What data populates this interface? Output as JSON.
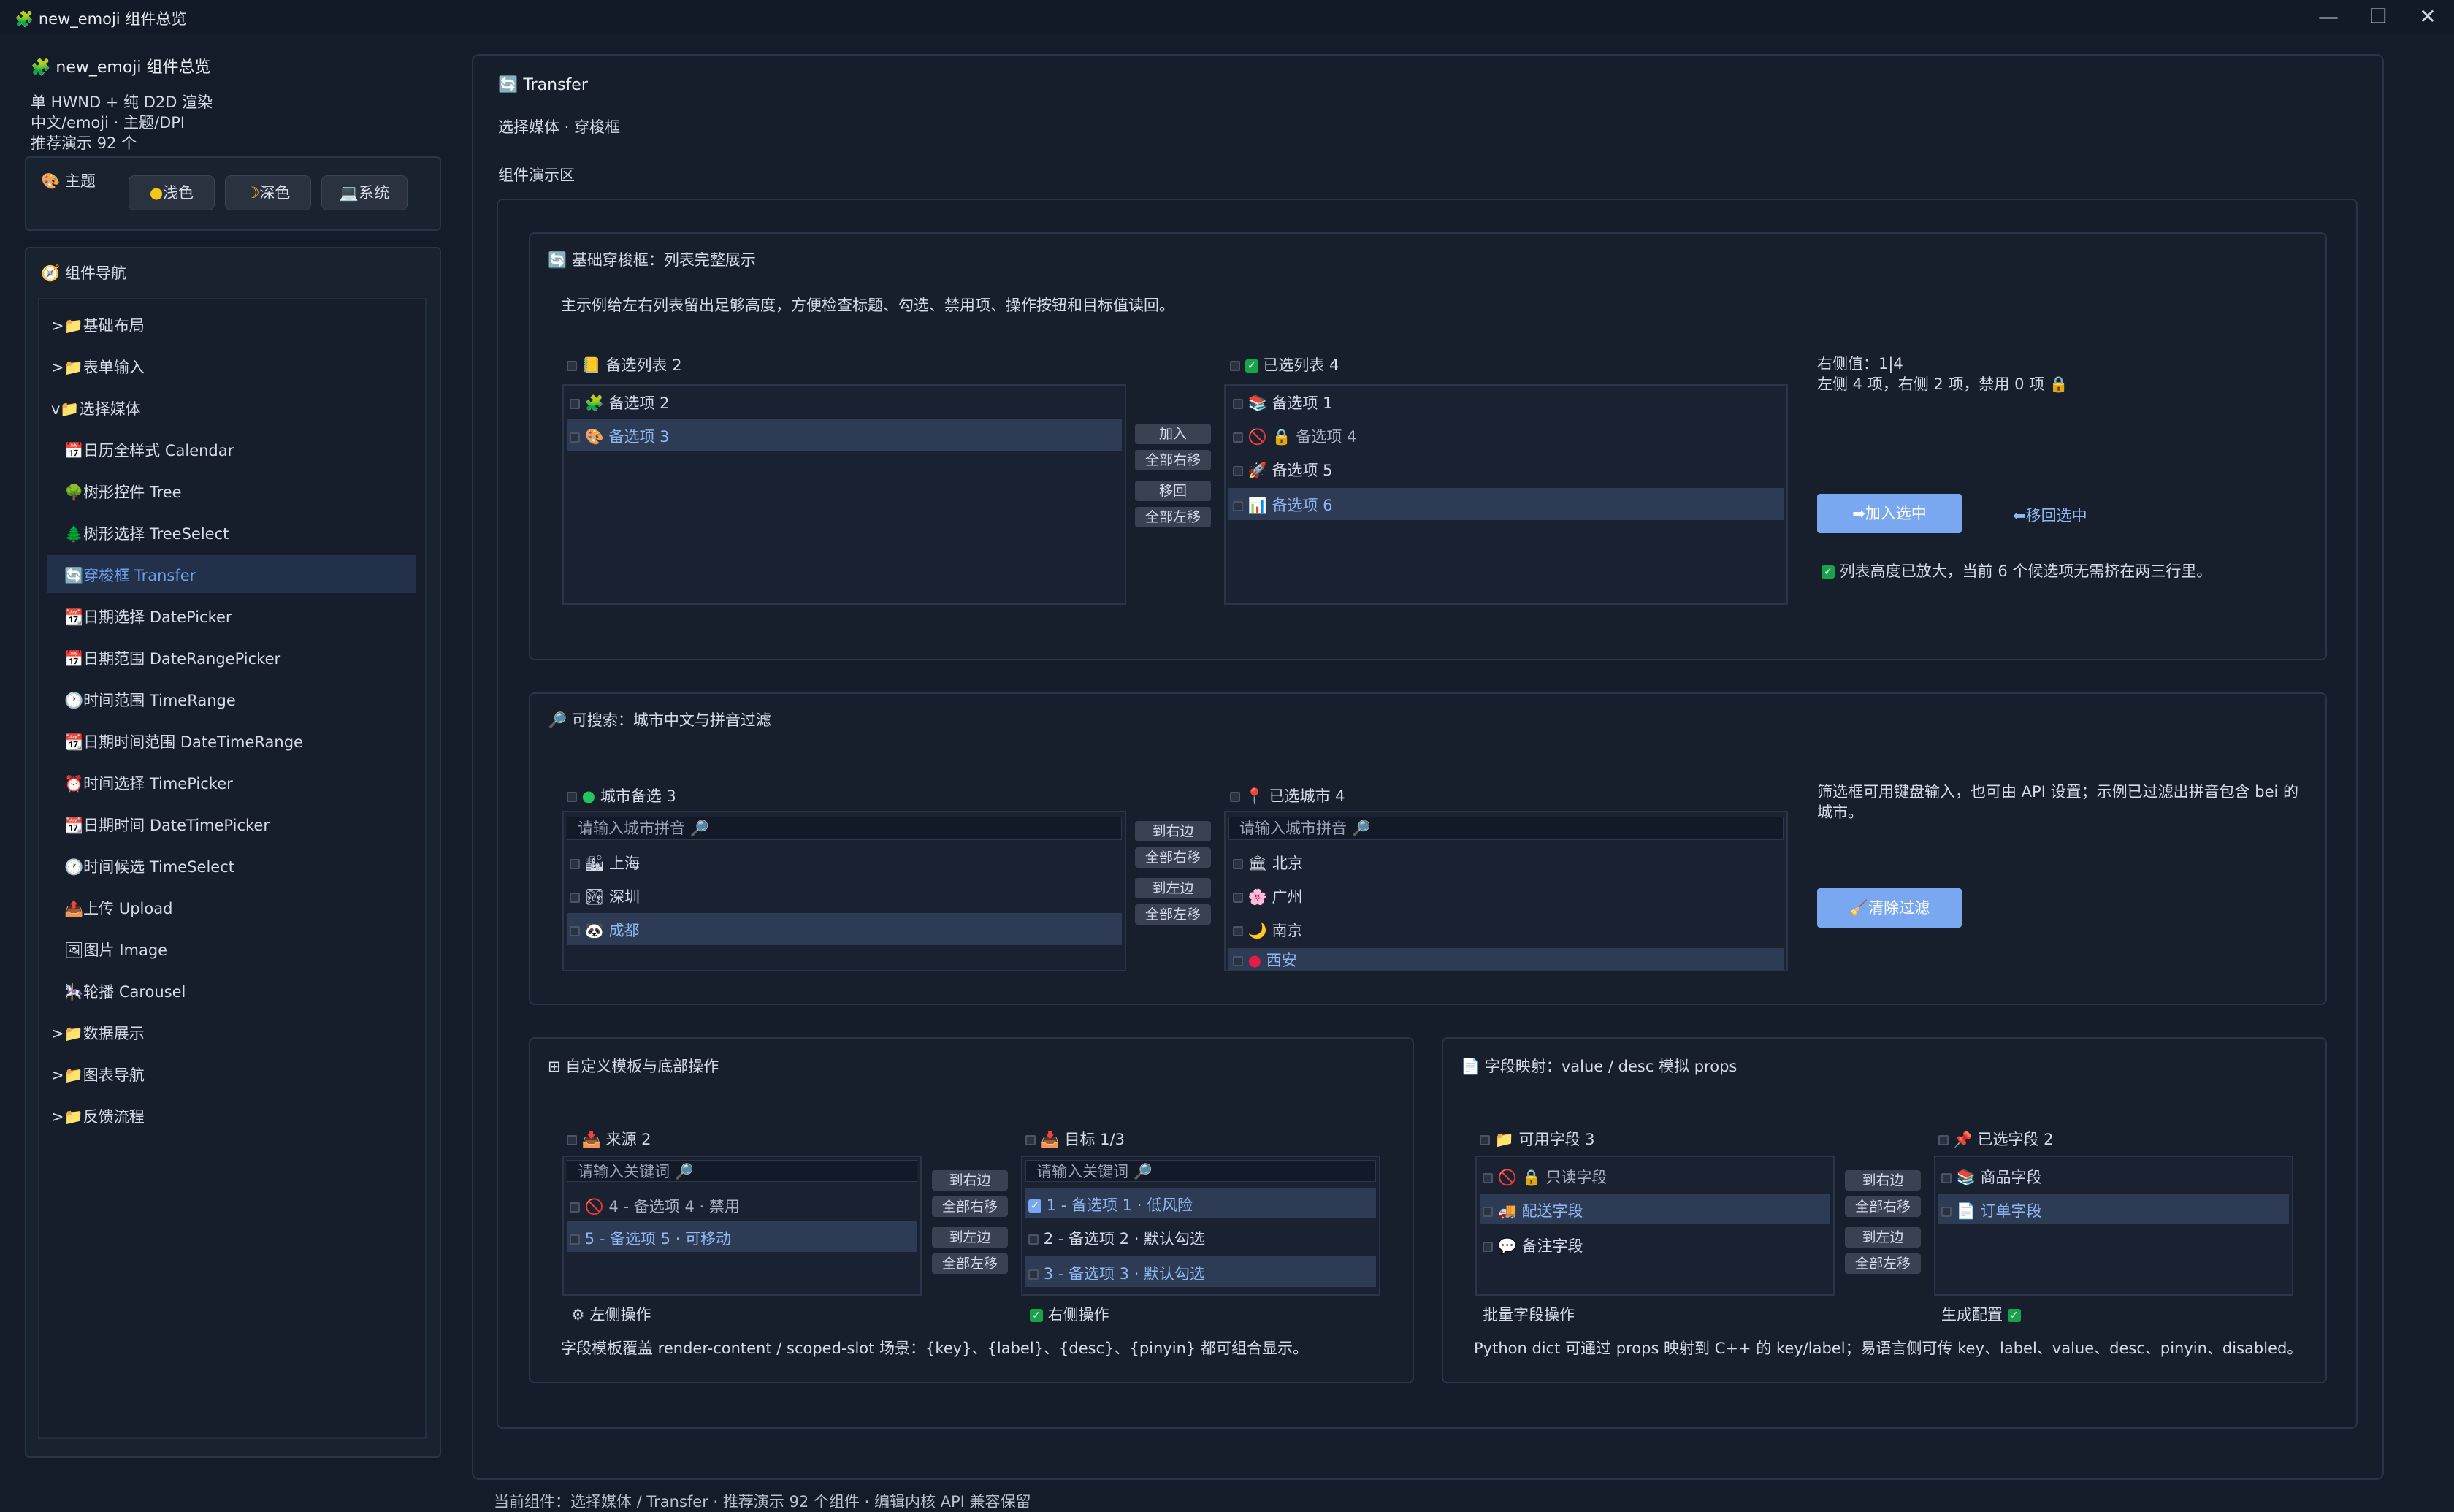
{
  "window": {
    "title": "new_emoji 组件总览",
    "app_icon": "🧩"
  },
  "sidebar": {
    "app_name": "new_emoji 组件总览",
    "info": [
      "单 HWND + 纯 D2D 渲染",
      "中文/emoji · 主题/DPI",
      "推荐演示 92 个"
    ],
    "theme": {
      "label": "主题",
      "icon": "🎨",
      "light": "浅色",
      "dark": "深色",
      "system": "系统"
    },
    "nav_title": "组件导航",
    "nav_icon": "🧭",
    "nav": [
      {
        "label": ">📁基础布局",
        "level": 0
      },
      {
        "label": ">📁表单输入",
        "level": 0
      },
      {
        "label": "v📁选择媒体",
        "level": 0
      },
      {
        "label": "📅日历全样式 Calendar",
        "level": 1
      },
      {
        "label": "🌳树形控件 Tree",
        "level": 1
      },
      {
        "label": "🌲树形选择 TreeSelect",
        "level": 1
      },
      {
        "label": "🔄穿梭框 Transfer",
        "level": 1,
        "selected": true
      },
      {
        "label": "📆日期选择 DatePicker",
        "level": 1
      },
      {
        "label": "📅日期范围 DateRangePicker",
        "level": 1
      },
      {
        "label": "🕐时间范围 TimeRange",
        "level": 1
      },
      {
        "label": "📆日期时间范围 DateTimeRange",
        "level": 1
      },
      {
        "label": "⏰时间选择 TimePicker",
        "level": 1
      },
      {
        "label": "📆日期时间 DateTimePicker",
        "level": 1
      },
      {
        "label": "🕐时间候选 TimeSelect",
        "level": 1
      },
      {
        "label": "📤上传 Upload",
        "level": 1
      },
      {
        "label": "🖼图片 Image",
        "level": 1
      },
      {
        "label": "🎠轮播 Carousel",
        "level": 1
      },
      {
        "label": ">📁数据展示",
        "level": 0
      },
      {
        "label": ">📁图表导航",
        "level": 0
      },
      {
        "label": ">📁反馈流程",
        "level": 0
      }
    ]
  },
  "main": {
    "title": "Transfer",
    "subtitle": "选择媒体 · 穿梭框",
    "demo_label": "组件演示区",
    "status": "当前组件：选择媒体 / Transfer · 推荐演示 92 个组件 · 编辑内核 API 兼容保留"
  },
  "sec1": {
    "title": "基础穿梭框：列表完整展示",
    "desc": "主示例给左右列表留出足够高度，方便检查标题、勾选、禁用项、操作按钮和目标值读回。",
    "left_title": "备选列表  2",
    "left_items": [
      "备选项 2",
      "备选项 3"
    ],
    "right_title": "已选列表  4",
    "right_items": [
      "备选项 1",
      "备选项 4",
      "备选项 5",
      "备选项 6"
    ],
    "ops": [
      "加入",
      "全部右移",
      "移回",
      "全部左移"
    ],
    "value_line1": "右侧值：1|4",
    "value_line2": "左侧 4 项，右侧 2 项，禁用 0 项 🔒",
    "btn_add": "➡加入选中",
    "btn_back": "⬅移回选中",
    "note": "列表高度已放大，当前 6 个候选项无需挤在两三行里。"
  },
  "sec2": {
    "title": "可搜索：城市中文与拼音过滤",
    "left_title": "城市备选  3",
    "right_title": "已选城市  4",
    "placeholder": "请输入城市拼音 🔎",
    "left_items": [
      "上海",
      "深圳",
      "成都"
    ],
    "right_items": [
      "北京",
      "广州",
      "南京",
      "西安"
    ],
    "ops": [
      "到右边",
      "全部右移",
      "到左边",
      "全部左移"
    ],
    "desc": "筛选框可用键盘输入，也可由 API 设置；示例已过滤出拼音包含 bei 的城市。",
    "btn_clear": "🧹清除过滤"
  },
  "sec3": {
    "title": "自定义模板与底部操作",
    "left_title": "来源  2",
    "right_title": "目标  1/3",
    "placeholder": "请输入关键词 🔎",
    "left_items": [
      "4 - 备选项 4 · 禁用",
      "5 - 备选项 5 · 可移动"
    ],
    "right_items": [
      "1 - 备选项 1 · 低风险",
      "2 - 备选项 2 · 默认勾选",
      "3 - 备选项 3 · 默认勾选"
    ],
    "ops": [
      "到右边",
      "全部右移",
      "到左边",
      "全部左移"
    ],
    "left_footer": "左侧操作",
    "right_footer": "右侧操作",
    "desc": "字段模板覆盖 render-content / scoped-slot 场景：{key}、{label}、{desc}、{pinyin} 都可组合显示。"
  },
  "sec4": {
    "title": "字段映射：value / desc 模拟 props",
    "left_title": "可用字段  3",
    "right_title": "已选字段  2",
    "left_items": [
      "只读字段",
      "配送字段",
      "备注字段"
    ],
    "right_items": [
      "商品字段",
      "订单字段"
    ],
    "ops": [
      "到右边",
      "全部右移",
      "到左边",
      "全部左移"
    ],
    "left_footer": "批量字段操作",
    "right_footer": "生成配置",
    "desc": "Python dict 可通过 props 映射到 C++ 的 key/label；易语言侧可传 key、label、value、desc、pinyin、disabled。"
  },
  "colors": {
    "bg": "#141c2a",
    "accent": "#7aa8f0",
    "selected_row": "#2d3b55",
    "check": "#17a34a"
  }
}
